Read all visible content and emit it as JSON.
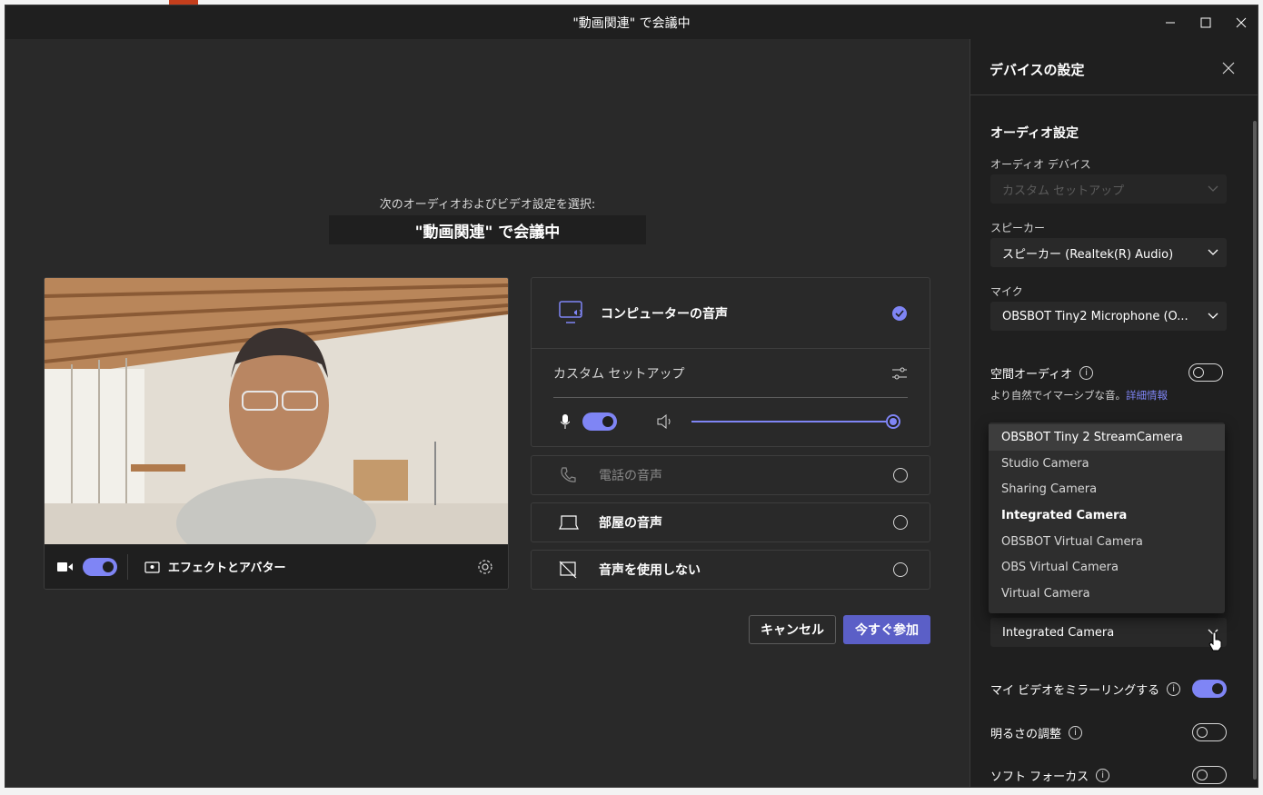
{
  "window": {
    "title": "\"動画関連\" で会議中"
  },
  "main": {
    "prompt": "次のオーディオおよびビデオ設定を選択:",
    "meeting_title": "\"動画関連\" で会議中",
    "video_bar": {
      "effects_label": "エフェクトとアバター",
      "camera_on": true
    },
    "audio_options": [
      {
        "label": "コンピューターの音声",
        "selected": true
      },
      {
        "label": "電話の音声",
        "selected": false
      },
      {
        "label": "部屋の音声",
        "selected": false
      },
      {
        "label": "音声を使用しない",
        "selected": false
      }
    ],
    "custom_setup": {
      "label": "カスタム セットアップ",
      "mic_on": true,
      "volume": 1.0
    },
    "buttons": {
      "cancel": "キャンセル",
      "join": "今すぐ参加"
    }
  },
  "panel": {
    "title": "デバイスの設定",
    "audio_section": "オーディオ設定",
    "audio_device_label": "オーディオ デバイス",
    "audio_device_value": "カスタム セットアップ",
    "speaker_label": "スピーカー",
    "speaker_value": "スピーカー (Realtek(R) Audio)",
    "mic_label": "マイク",
    "mic_value": "OBSBOT Tiny2 Microphone (O...",
    "spatial_audio_label": "空間オーディオ",
    "spatial_audio_on": false,
    "spatial_audio_desc": "より自然でイマーシブな音。",
    "spatial_audio_link": "詳細情報",
    "camera_value": "Integrated Camera",
    "camera_options": [
      "OBSBOT Tiny 2 StreamCamera",
      "Studio Camera",
      "Sharing Camera",
      "Integrated Camera",
      "OBSBOT Virtual Camera",
      "OBS Virtual Camera",
      "Virtual Camera"
    ],
    "mirror_label": "マイ ビデオをミラーリングする",
    "mirror_on": true,
    "brightness_label": "明るさの調整",
    "brightness_on": false,
    "soft_focus_label": "ソフト フォーカス",
    "soft_focus_on": false
  },
  "colors": {
    "accent": "#7f85f5",
    "primary_button": "#5b5fc7",
    "link": "#7f85f5"
  }
}
